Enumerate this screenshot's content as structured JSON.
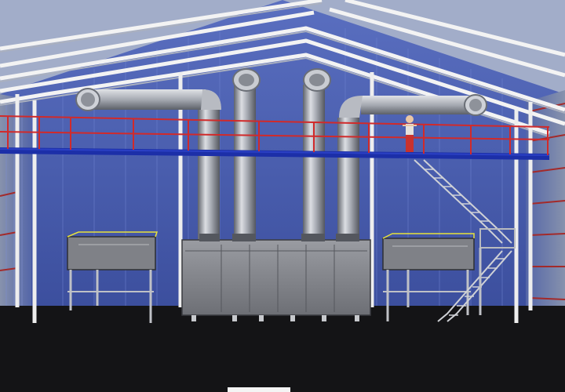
{
  "viewport": {
    "kind": "3d-render",
    "subject": "industrial-hall-with-exhaust-ducts"
  },
  "palette": {
    "sky_top": "#a9b5d1",
    "back_wall": "#4e63b4",
    "back_wall_light": "#6f81c8",
    "floor": "#151517",
    "frame": "#f2f2f2",
    "frame_shadow": "#9aa0ad",
    "duct_light": "#d8dadf",
    "duct_mid": "#9ea2aa",
    "duct_dark": "#5e626b",
    "mezzanine_blue": "#1b2fa6",
    "railing_red": "#d12a2a",
    "machine_fill": "#8a8c92",
    "machine_edge": "#3a3b40",
    "accent_yellow": "#e8e23a",
    "worker_red": "#c8322d",
    "worker_skin": "#e9c6a4"
  },
  "objects": {
    "roof_truss": "roof-truss",
    "exhaust_ducts": [
      "duct-1",
      "duct-2",
      "duct-3",
      "duct-4"
    ],
    "mezzanine": "mezzanine-platform",
    "staircase": "staircase",
    "furnace_unit": "furnace-unit",
    "left_table": "work-table-left",
    "right_table": "work-table-right",
    "worker": "worker-figure"
  }
}
